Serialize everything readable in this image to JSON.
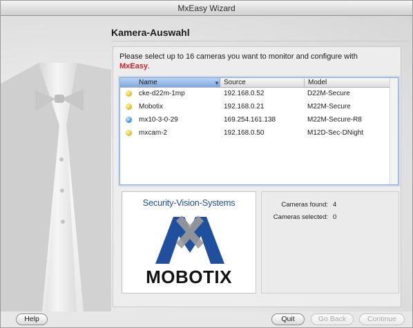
{
  "window": {
    "title": "MxEasy Wizard"
  },
  "page": {
    "heading": "Kamera-Auswahl",
    "intro_text": "Please select up to 16 cameras you want to monitor and configure with",
    "brand_mx": "Mx",
    "brand_easy": "Easy",
    "brand_period": "."
  },
  "camera_table": {
    "columns": [
      "Name",
      "Source",
      "Model"
    ],
    "rows": [
      {
        "status": "yellow",
        "name": "cke-d22m-1mp",
        "source": "192.168.0.52",
        "model": "D22M-Secure"
      },
      {
        "status": "yellow",
        "name": "Mobotix",
        "source": "192.168.0.21",
        "model": "M22M-Secure"
      },
      {
        "status": "blue",
        "name": "mx10-3-0-29",
        "source": "169.254.161.138",
        "model": "M22M-Secure-R8"
      },
      {
        "status": "yellow",
        "name": "mxcam-2",
        "source": "192.168.0.50",
        "model": "M12D-Sec-DNight"
      }
    ],
    "sort_indicator": "▼"
  },
  "logo": {
    "top_text": "Security-Vision-Systems",
    "bottom_text": "MOBOTIX"
  },
  "stats": {
    "found_label": "Cameras found:",
    "found_value": "4",
    "selected_label": "Cameras selected:",
    "selected_value": "0"
  },
  "buttons": {
    "help": "Help",
    "quit": "Quit",
    "go_back": "Go Back",
    "continue": "Continue"
  },
  "colors": {
    "brand_red": "#d41f2b",
    "mobotix_blue": "#1f4f9d",
    "selection_blue": "#7ea8dd"
  }
}
